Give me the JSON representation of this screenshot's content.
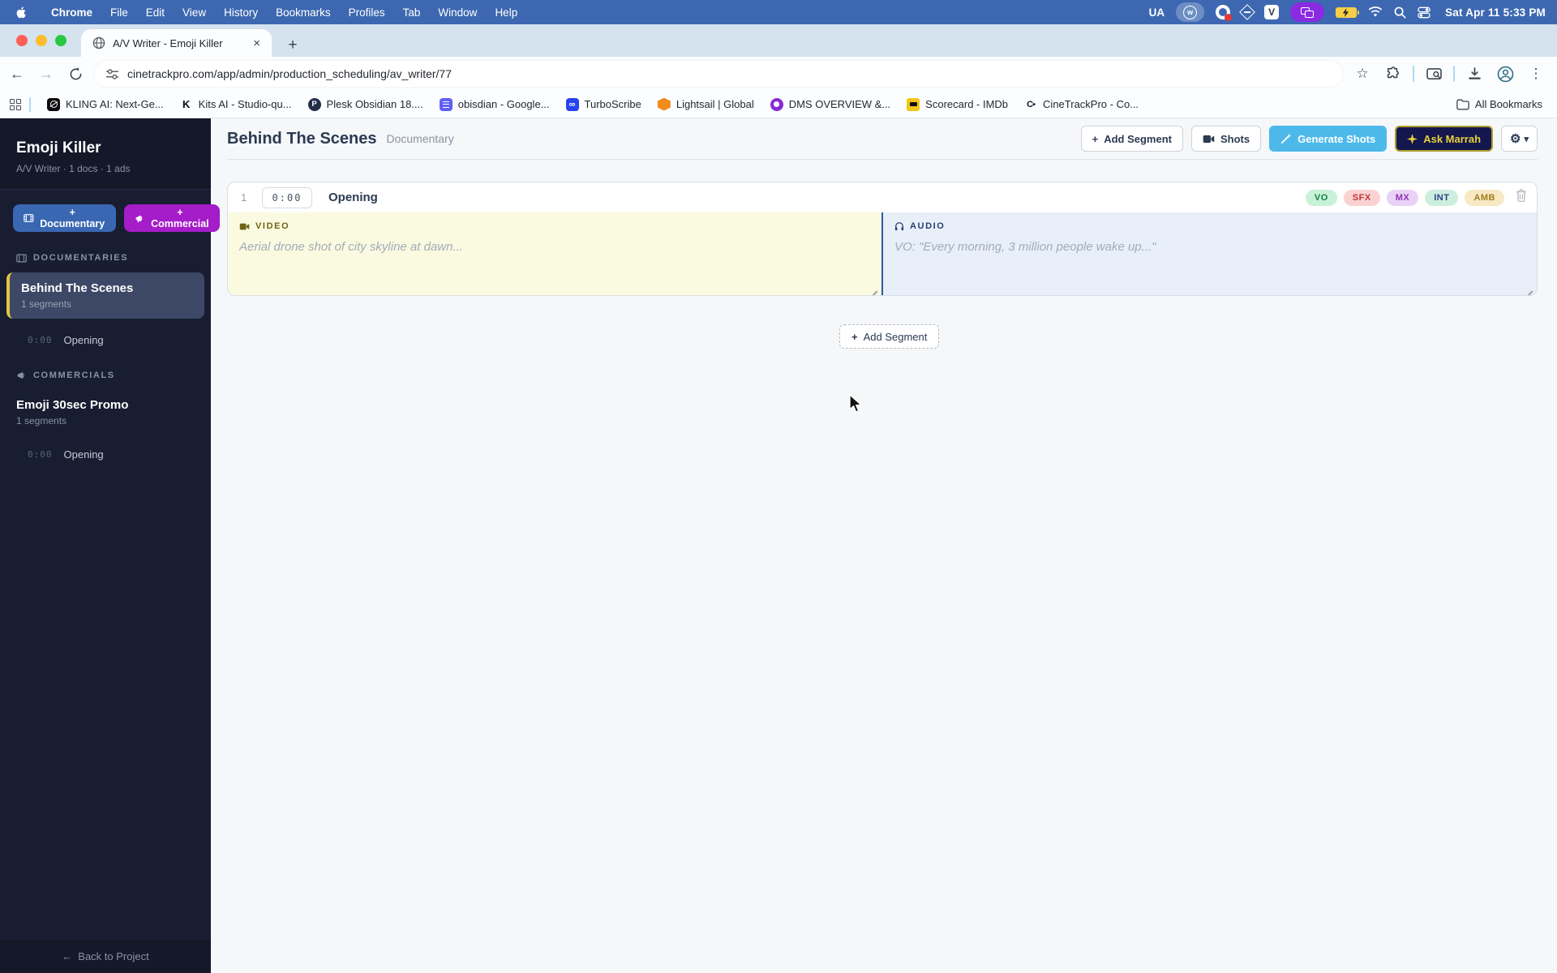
{
  "colors": {
    "menubar_bg": "#3d68b1",
    "sidebar_bg": "#181d31",
    "documentary_button": "#3a67b2",
    "commercial_button": "#a51cc9",
    "selected_highlight": "#e2c53e",
    "generate_shots_button": "#4db9ea",
    "ask_marrah_bg": "#14174d",
    "ask_marrah_text": "#e8d23c",
    "video_panel_bg": "#fafae1",
    "audio_panel_bg": "#e9eff8",
    "badge_vo": "#c8f2d7",
    "badge_sfx": "#fad2d2",
    "badge_mx": "#e9d2f6",
    "badge_int": "#cdeede",
    "badge_amb": "#f7e9c4"
  },
  "icons": {
    "plus": "+",
    "gear": "⚙",
    "chevron_down": "▾",
    "kebab": "⋮",
    "star": "☆",
    "back": "←",
    "forward": "→",
    "tab_close": "×",
    "new_tab": "+",
    "circle_w": "w",
    "v_badge": "V",
    "plesk_letter": "P",
    "kits_letter": "K",
    "infinity": "∞",
    "cinetrack_glyph": "C▪"
  },
  "menubar": {
    "menus": [
      "Chrome",
      "File",
      "Edit",
      "View",
      "History",
      "Bookmarks",
      "Profiles",
      "Tab",
      "Window",
      "Help"
    ],
    "input_source": "UA",
    "clock": "Sat Apr 11 5:33 PM"
  },
  "browser": {
    "tab_title": "A/V Writer - Emoji Killer",
    "url": "cinetrackpro.com/app/admin/production_scheduling/av_writer/77",
    "bookmarks": [
      {
        "label": "KLING AI: Next-Ge..."
      },
      {
        "label": "Kits AI - Studio-qu..."
      },
      {
        "label": "Plesk Obsidian 18...."
      },
      {
        "label": "obisdian - Google..."
      },
      {
        "label": "TurboScribe"
      },
      {
        "label": "Lightsail | Global"
      },
      {
        "label": "DMS OVERVIEW &..."
      },
      {
        "label": "Scorecard - IMDb"
      },
      {
        "label": "CineTrackPro - Co..."
      }
    ],
    "all_bookmarks_label": "All Bookmarks"
  },
  "sidebar": {
    "project_title": "Emoji Killer",
    "project_subtitle": "A/V Writer · 1 docs · 1 ads",
    "add_documentary_label": "+ Documentary",
    "add_commercial_label": "+ Commercial",
    "documentaries_header": "DOCUMENTARIES",
    "commercials_header": "COMMERCIALS",
    "documentaries": [
      {
        "title": "Behind The Scenes",
        "meta": "1 segments",
        "segments": [
          {
            "time": "0:00",
            "title": "Opening"
          }
        ]
      }
    ],
    "commercials": [
      {
        "title": "Emoji 30sec Promo",
        "meta": "1 segments",
        "segments": [
          {
            "time": "0:00",
            "title": "Opening"
          }
        ]
      }
    ],
    "back_label": "Back to Project"
  },
  "main": {
    "title": "Behind The Scenes",
    "doc_type": "Documentary",
    "toolbar": {
      "add_segment": "Add Segment",
      "shots": "Shots",
      "generate_shots": "Generate Shots",
      "ask_marrah": "Ask Marrah"
    },
    "segment": {
      "number": "1",
      "time": "0:00",
      "title": "Opening",
      "badges": [
        "VO",
        "SFX",
        "MX",
        "INT",
        "AMB"
      ],
      "video_label": "VIDEO",
      "video_placeholder": "Aerial drone shot of city skyline at dawn...",
      "audio_label": "AUDIO",
      "audio_placeholder": "VO: \"Every morning, 3 million people wake up...\""
    },
    "add_segment_bottom": "Add Segment"
  }
}
